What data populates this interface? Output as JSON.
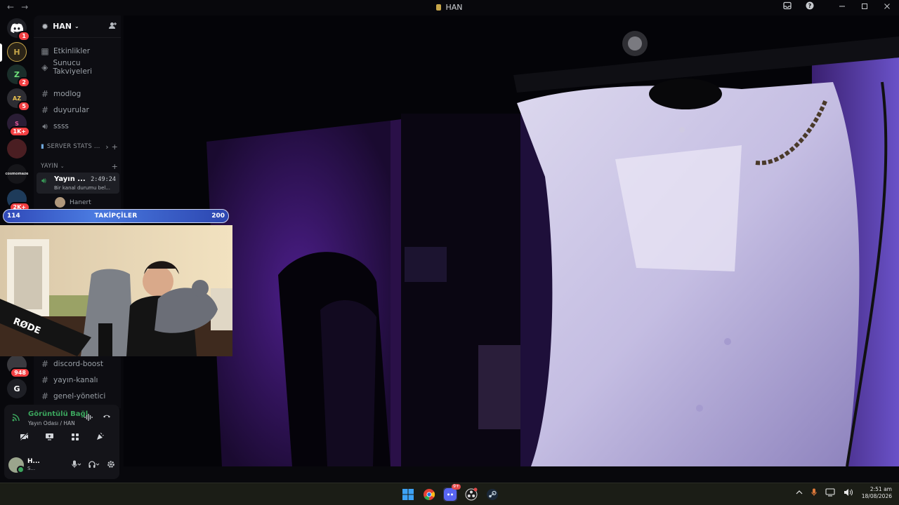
{
  "window": {
    "title": "HAN",
    "back_glyph": "←",
    "forward_glyph": "→",
    "right_icons": [
      "inbox-icon",
      "help-icon",
      "minimize-icon",
      "maximize-icon",
      "close-icon"
    ]
  },
  "rail": {
    "items": [
      {
        "name": "discord-home",
        "badge": "1"
      },
      {
        "name": "server-han",
        "badge": ""
      },
      {
        "name": "server-z",
        "badge": "2"
      },
      {
        "name": "server-az",
        "badge": "5"
      },
      {
        "name": "server-s",
        "badge": "1K+"
      },
      {
        "name": "server-red",
        "badge": ""
      },
      {
        "name": "server-cosmos",
        "label": "cosmomaze",
        "badge": ""
      },
      {
        "name": "server-cat",
        "badge": "2K+"
      },
      {
        "name": "server-948",
        "badge": "948"
      },
      {
        "name": "server-g",
        "label": "G",
        "badge": ""
      }
    ]
  },
  "server": {
    "name": "HAN",
    "chevron": "⌄"
  },
  "channels": {
    "events": "Etkinlikler",
    "boosts": "Sunucu Takviyeleri",
    "text": [
      "modlog",
      "duyurular"
    ],
    "voice": "ssss",
    "stats_category": "SERVER STATS ...",
    "stream_category": "YAYIN",
    "live_channel": {
      "name": "Yayın ...",
      "time": "2:49:24",
      "status": "Bir kanal durumu bel..."
    },
    "member": "Hanert",
    "lower_text": [
      "discord-boost",
      "yayın-kanalı",
      "genel-yönetici"
    ]
  },
  "voice_panel": {
    "status": "Görüntülü Bağl",
    "room": "Yayın Odası / HAN",
    "user_name": "H...",
    "user_status": "S..."
  },
  "overlay": {
    "current": "114",
    "label": "TAKİPÇİLER",
    "goal": "200",
    "progress": 0.57,
    "mic_brand": "RØDE"
  },
  "taskbar": {
    "discord_badge": "9+",
    "time": "2:51 am",
    "date": "18/08/2026"
  }
}
